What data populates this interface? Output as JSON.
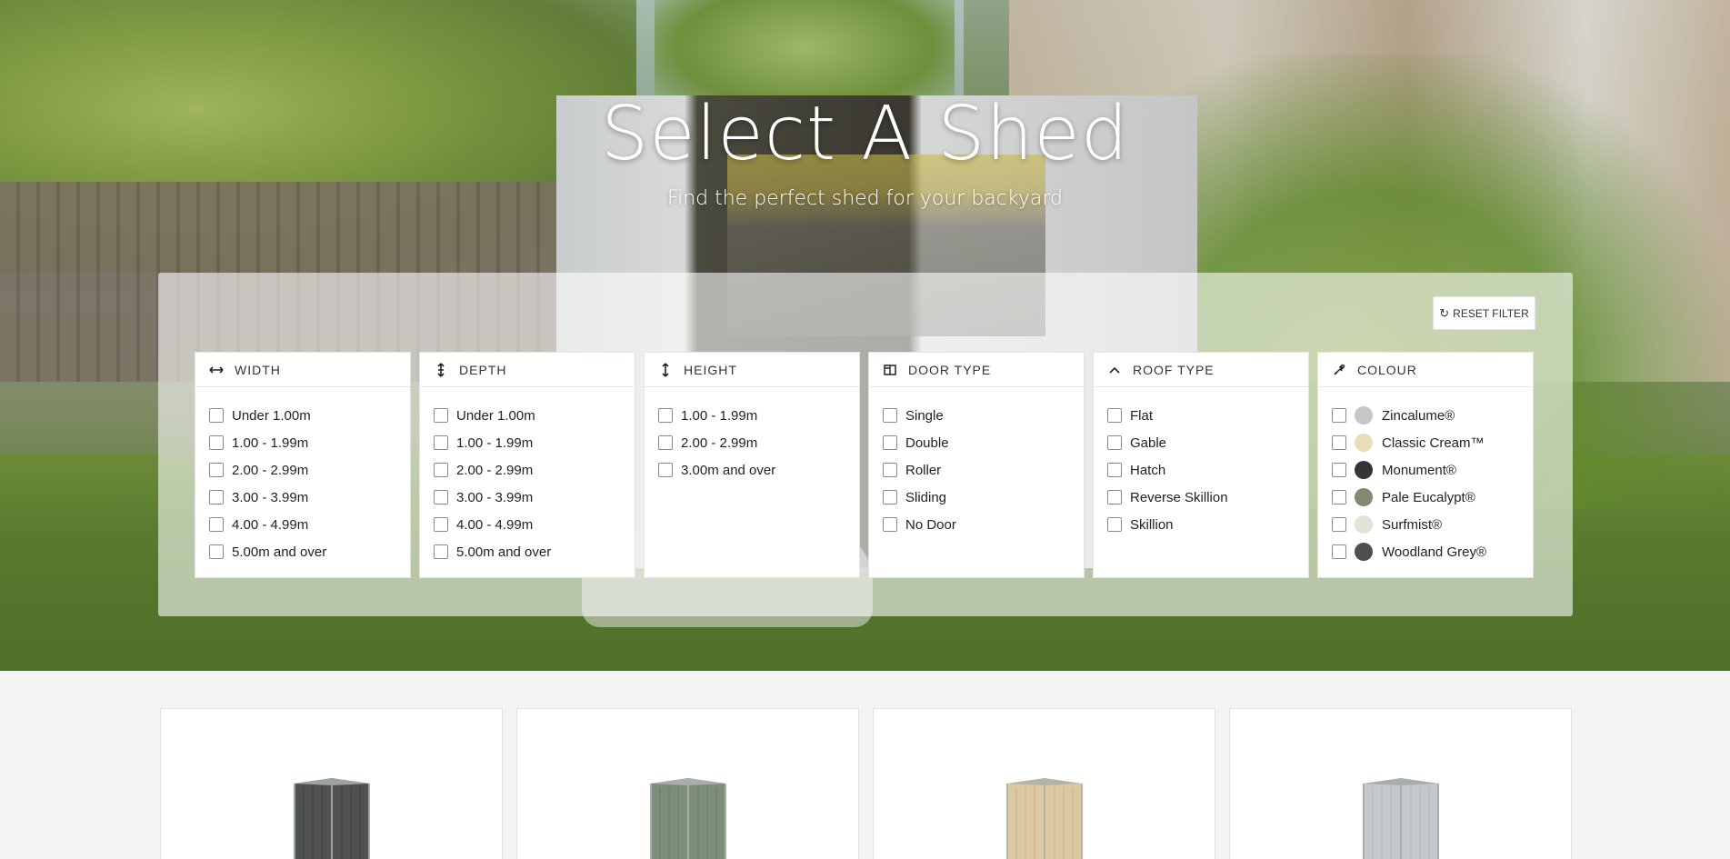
{
  "hero": {
    "title": "Select A Shed",
    "subtitle": "Find the perfect shed for your backyard"
  },
  "filter": {
    "reset_label": "RESET FILTER",
    "reset_icon": "refresh-icon",
    "groups": [
      {
        "title": "WIDTH",
        "icon": "arrows-horizontal-icon",
        "options": [
          "Under 1.00m",
          "1.00 - 1.99m",
          "2.00 - 2.99m",
          "3.00 - 3.99m",
          "4.00 - 4.99m",
          "5.00m and over"
        ]
      },
      {
        "title": "DEPTH",
        "icon": "arrows-depth-icon",
        "options": [
          "Under 1.00m",
          "1.00 - 1.99m",
          "2.00 - 2.99m",
          "3.00 - 3.99m",
          "4.00 - 4.99m",
          "5.00m and over"
        ]
      },
      {
        "title": "HEIGHT",
        "icon": "arrows-vertical-icon",
        "options": [
          "1.00 - 1.99m",
          "2.00 - 2.99m",
          "3.00m and over"
        ]
      },
      {
        "title": "DOOR TYPE",
        "icon": "door-icon",
        "options": [
          "Single",
          "Double",
          "Roller",
          "Sliding",
          "No Door"
        ]
      },
      {
        "title": "ROOF TYPE",
        "icon": "roof-chevron-icon",
        "options": [
          "Flat",
          "Gable",
          "Hatch",
          "Reverse Skillion",
          "Skillion"
        ]
      },
      {
        "title": "COLOUR",
        "icon": "eyedropper-icon",
        "options": [
          "Zincalume®",
          "Classic Cream™",
          "Monument®",
          "Pale Eucalypt®",
          "Surfmist®",
          "Woodland Grey®"
        ],
        "swatches": [
          "#c4c6c7",
          "#e9dcb8",
          "#333536",
          "#7f8a6f",
          "#e4e3da",
          "#4e504c"
        ]
      }
    ]
  },
  "products": [
    {
      "colour": "#4f524f",
      "frame": "#9da3a2"
    },
    {
      "colour": "#7d8f78",
      "frame": "#a8aea9"
    },
    {
      "colour": "#dcc9a2",
      "frame": "#b5b2a8"
    },
    {
      "colour": "#c5c8ca",
      "frame": "#a7acae"
    }
  ]
}
